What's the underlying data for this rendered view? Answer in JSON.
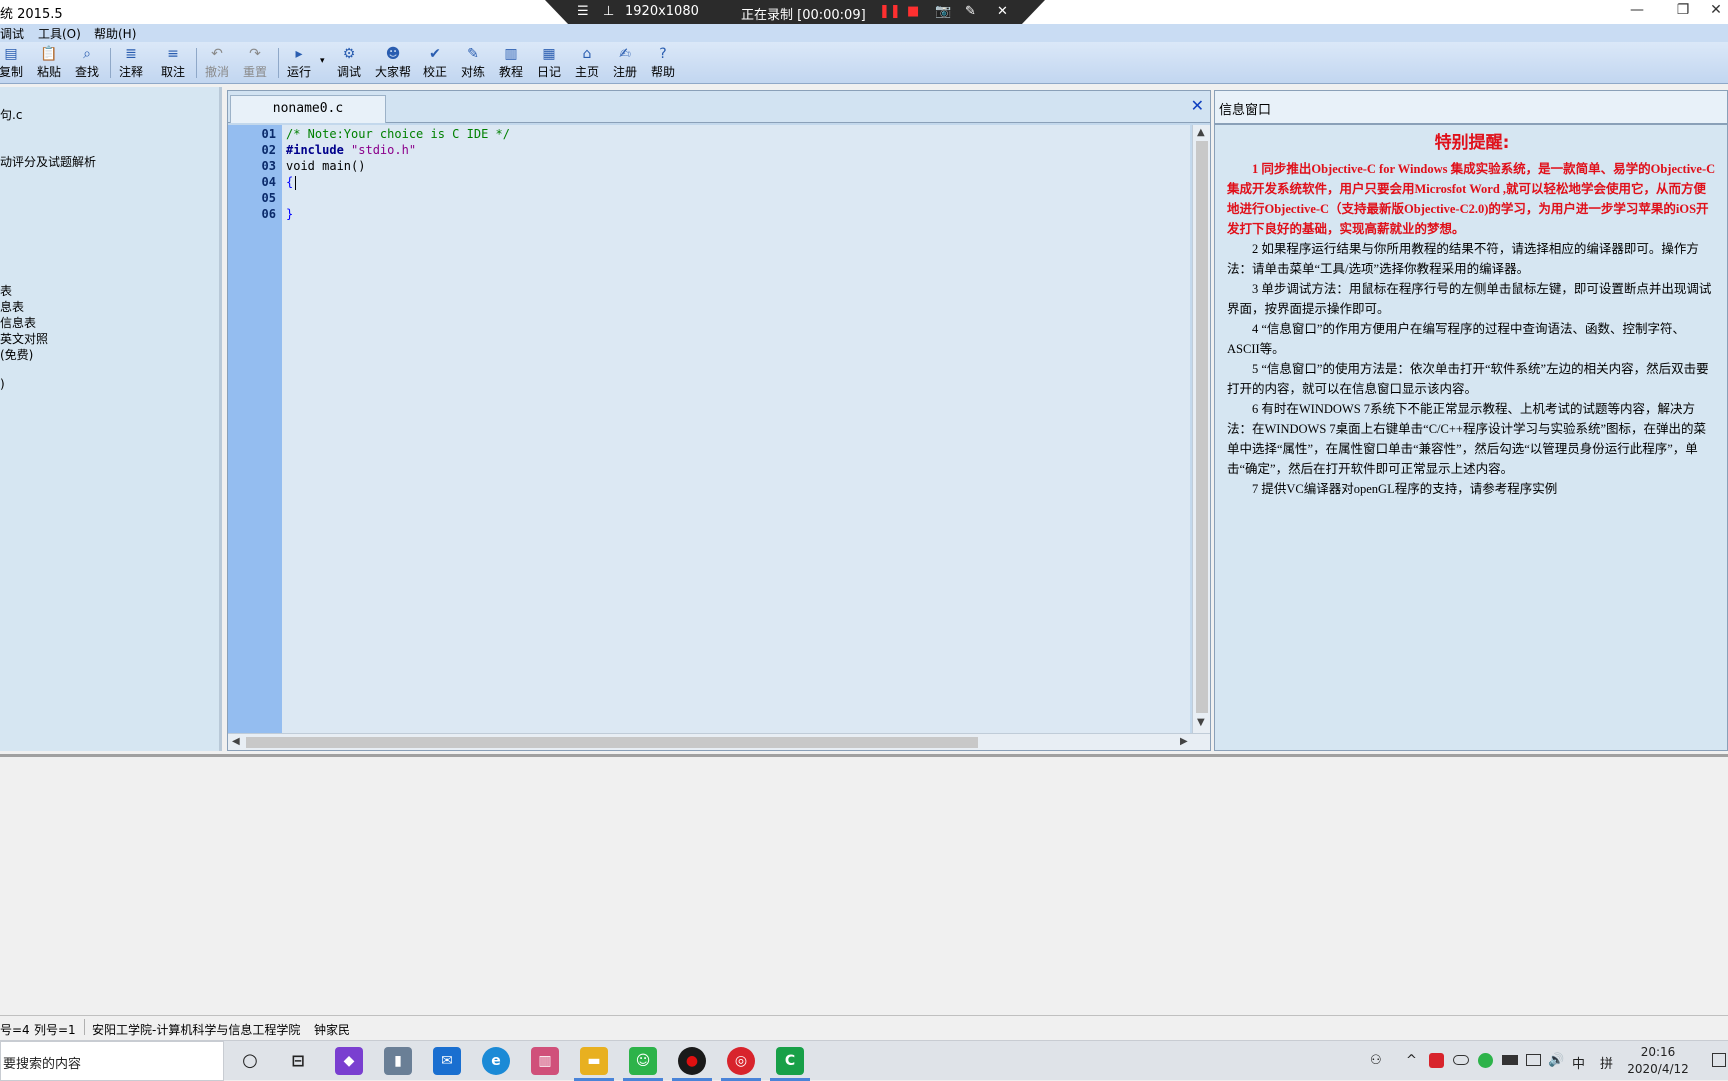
{
  "window": {
    "title": "统 2015.5",
    "controls": {
      "minimize": "—",
      "maximize": "❐",
      "close": "✕"
    }
  },
  "recorder": {
    "menu_icon": "☰",
    "pin_icon": "⊥",
    "resolution": "1920x1080",
    "status": "正在录制 [00:00:09]",
    "pause_icon": "❚❚",
    "stop_icon": "■",
    "camera_icon": "📷",
    "pen_icon": "✎",
    "close_icon": "✕"
  },
  "menubar": {
    "items": [
      {
        "label": "调试"
      },
      {
        "label": "工具(O)"
      },
      {
        "label": "帮助(H)"
      }
    ]
  },
  "toolbar": {
    "buttons": [
      {
        "label": "复制",
        "icon": "▤"
      },
      {
        "label": "粘贴",
        "icon": "📋"
      },
      {
        "label": "查找",
        "icon": "⌕"
      },
      {
        "label": "注释",
        "icon": "≣"
      },
      {
        "label": "取注",
        "icon": "≡"
      },
      {
        "label": "撤消",
        "icon": "↶"
      },
      {
        "label": "重置",
        "icon": "↷"
      },
      {
        "label": "运行",
        "icon": "▸",
        "dropdown": "▾"
      },
      {
        "label": "调试",
        "icon": "⚙"
      },
      {
        "label": "大家帮",
        "icon": "☻"
      },
      {
        "label": "校正",
        "icon": "✔"
      },
      {
        "label": "对练",
        "icon": "✎"
      },
      {
        "label": "教程",
        "icon": "▥"
      },
      {
        "label": "日记",
        "icon": "▦"
      },
      {
        "label": "主页",
        "icon": "⌂"
      },
      {
        "label": "注册",
        "icon": "✍"
      },
      {
        "label": "帮助",
        "icon": "?"
      }
    ]
  },
  "sidebar": {
    "items": [
      {
        "label": "句.c"
      },
      {
        "label": "动评分及试题解析"
      },
      {
        "label": "表"
      },
      {
        "label": "息表"
      },
      {
        "label": "信息表"
      },
      {
        "label": "英文对照"
      },
      {
        "label": "(免费)"
      },
      {
        "label": ")"
      }
    ]
  },
  "editor": {
    "tab_label": "noname0.c",
    "close_icon": "✕",
    "lines": [
      {
        "num": "01",
        "text": "/* Note:Your choice is C IDE */"
      },
      {
        "num": "02",
        "text_directive": "#include ",
        "text_string": "\"stdio.h\""
      },
      {
        "num": "03",
        "text": "void main()"
      },
      {
        "num": "04",
        "text": "{"
      },
      {
        "num": "05",
        "text": ""
      },
      {
        "num": "06",
        "text": "}"
      }
    ],
    "colors": {
      "comment": "#008000",
      "directive": "#00008b",
      "string": "#8b008b",
      "brace": "#0000ff"
    }
  },
  "info": {
    "header": "信息窗口",
    "title": "特别提醒:",
    "paragraphs": [
      {
        "text": "1 同步推出Objective-C for Windows 集成实验系统，是一款简单、易学的Objective-C集成开发系统软件，用户只要会用Microsfot Word ,就可以轻松地学会使用它，从而方便地进行Objective-C（支持最新版Objective-C2.0)的学习，为用户进一步学习苹果的iOS开发打下良好的基础，实现高薪就业的梦想。",
        "highlight": true
      },
      {
        "text": "2 如果程序运行结果与你所用教程的结果不符，请选择相应的编译器即可。操作方法：请单击菜单“工具/选项”选择你教程采用的编译器。",
        "highlight": false
      },
      {
        "text": "3 单步调试方法：用鼠标在程序行号的左侧单击鼠标左键，即可设置断点并出现调试界面，按界面提示操作即可。",
        "highlight": false
      },
      {
        "text": "4 “信息窗口”的作用方便用户在编写程序的过程中查询语法、函数、控制字符、ASCII等。",
        "highlight": false
      },
      {
        "text": "5 “信息窗口”的使用方法是：依次单击打开“软件系统”左边的相关内容，然后双击要打开的内容，就可以在信息窗口显示该内容。",
        "highlight": false
      },
      {
        "text": "6 有时在WINDOWS 7系统下不能正常显示教程、上机考试的试题等内容，解决方法：在WINDOWS 7桌面上右键单击“C/C++程序设计学习与实验系统”图标，在弹出的菜单中选择“属性”，在属性窗口单击“兼容性”，然后勾选“以管理员身份运行此程序”，单击“确定”，然后在打开软件即可正常显示上述内容。",
        "highlight": false
      },
      {
        "text": "7 提供VC编译器对openGL程序的支持，请参考程序实例",
        "highlight": false
      }
    ]
  },
  "statusbar": {
    "line": "号=4",
    "col": "列号=1",
    "org": "安阳工学院-计算机科学与信息工程学院",
    "author": "钟家民"
  },
  "taskbar": {
    "search_placeholder": "要搜索的内容",
    "cortana_icon": "○",
    "taskview_icon": "⊟",
    "apps": [
      {
        "name": "app-purple-icon",
        "color": "#7a3fd0",
        "glyph": "◆"
      },
      {
        "name": "trash-icon",
        "color": "#6a7f96",
        "glyph": "▮"
      },
      {
        "name": "mail-icon",
        "color": "#1a6fd0",
        "glyph": "✉"
      },
      {
        "name": "edge-icon",
        "color": "#1b8ad6",
        "glyph": "e"
      },
      {
        "name": "media-icon",
        "color": "#d0507a",
        "glyph": "▥"
      },
      {
        "name": "folder-icon",
        "color": "#e8b020",
        "glyph": "▬"
      },
      {
        "name": "wechat-icon",
        "color": "#2db34a",
        "glyph": "☺"
      },
      {
        "name": "recorder-icon",
        "color": "#1a1a1a",
        "glyph": "●"
      },
      {
        "name": "netease-music-icon",
        "color": "#d8242c",
        "glyph": "◎"
      },
      {
        "name": "c-ide-icon",
        "color": "#18a048",
        "glyph": "C"
      }
    ],
    "tray": {
      "people_icon": "⚇",
      "chevron_icon": "^",
      "ime": "中",
      "ime_mode": "拼",
      "volume_icon": "🔊"
    },
    "time": "20:16",
    "date": "2020/4/12"
  }
}
